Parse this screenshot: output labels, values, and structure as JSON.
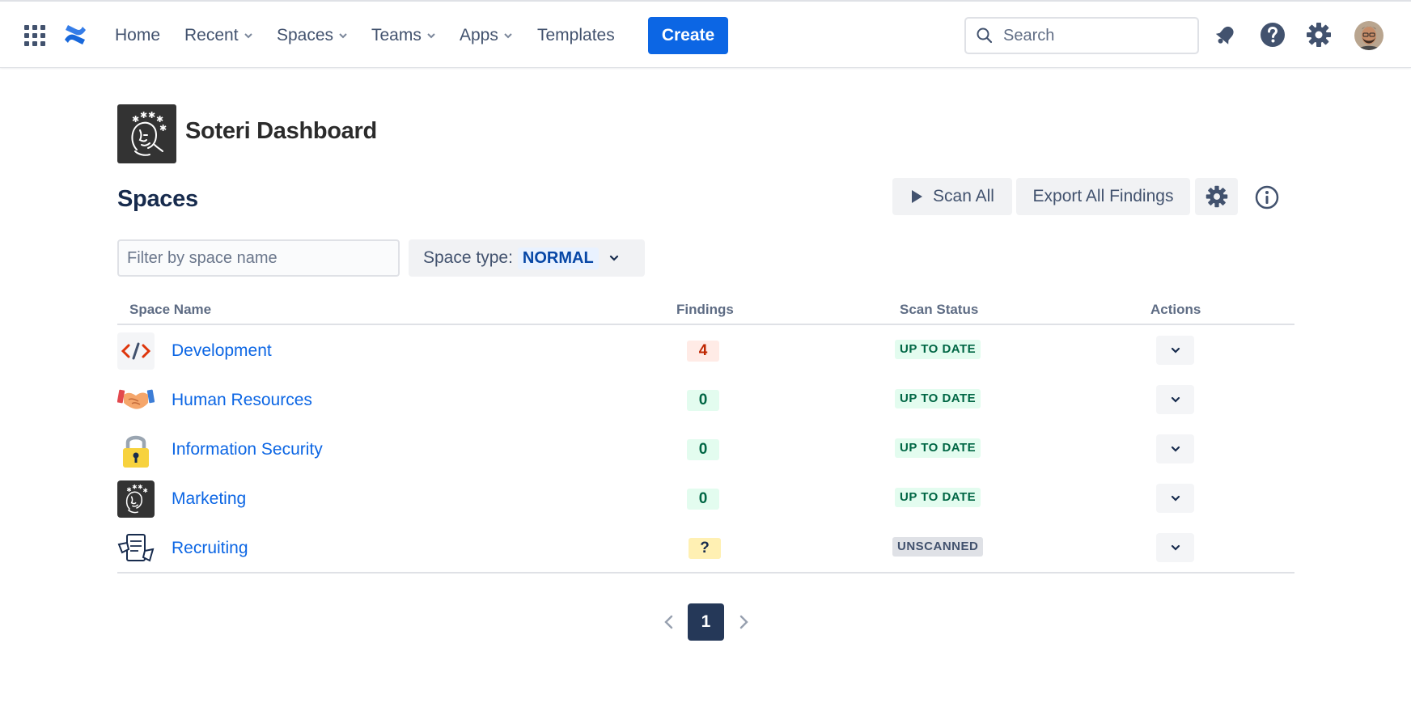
{
  "nav": {
    "items": [
      {
        "label": "Home",
        "has_chevron": false
      },
      {
        "label": "Recent",
        "has_chevron": true
      },
      {
        "label": "Spaces",
        "has_chevron": true
      },
      {
        "label": "Teams",
        "has_chevron": true
      },
      {
        "label": "Apps",
        "has_chevron": true
      },
      {
        "label": "Templates",
        "has_chevron": false
      }
    ],
    "create_label": "Create",
    "search_placeholder": "Search",
    "icons": [
      "app-switcher-icon",
      "confluence-logo-icon",
      "notification-bell-icon",
      "help-icon",
      "settings-gear-icon"
    ]
  },
  "page": {
    "title": "Soteri Dashboard",
    "section_title": "Spaces",
    "scan_all_label": "Scan All",
    "export_label": "Export All Findings",
    "filter_placeholder": "Filter by space name",
    "space_type_label": "Space type:",
    "space_type_value": "NORMAL"
  },
  "table": {
    "columns": [
      "Space Name",
      "Findings",
      "Scan Status",
      "Actions"
    ],
    "rows": [
      {
        "name": "Development",
        "icon": "code-icon",
        "findings": "4",
        "findings_kind": "red",
        "status": "UP TO DATE",
        "status_kind": "ok"
      },
      {
        "name": "Human Resources",
        "icon": "handshake-icon",
        "findings": "0",
        "findings_kind": "green",
        "status": "UP TO DATE",
        "status_kind": "ok"
      },
      {
        "name": "Information Security",
        "icon": "padlock-icon",
        "findings": "0",
        "findings_kind": "green",
        "status": "UP TO DATE",
        "status_kind": "ok"
      },
      {
        "name": "Marketing",
        "icon": "soteri-logo-icon",
        "findings": "0",
        "findings_kind": "green",
        "status": "UP TO DATE",
        "status_kind": "ok"
      },
      {
        "name": "Recruiting",
        "icon": "document-hands-icon",
        "findings": "?",
        "findings_kind": "yellow",
        "status": "UNSCANNED",
        "status_kind": "none"
      }
    ]
  },
  "pagination": {
    "current_page": "1"
  },
  "colors": {
    "primary": "#0c66e4",
    "text": "#172b4d",
    "subtle": "#42526e",
    "danger_bg": "#ffebe6",
    "success_bg": "#e3fcef",
    "warning_bg": "#fff0b3"
  }
}
